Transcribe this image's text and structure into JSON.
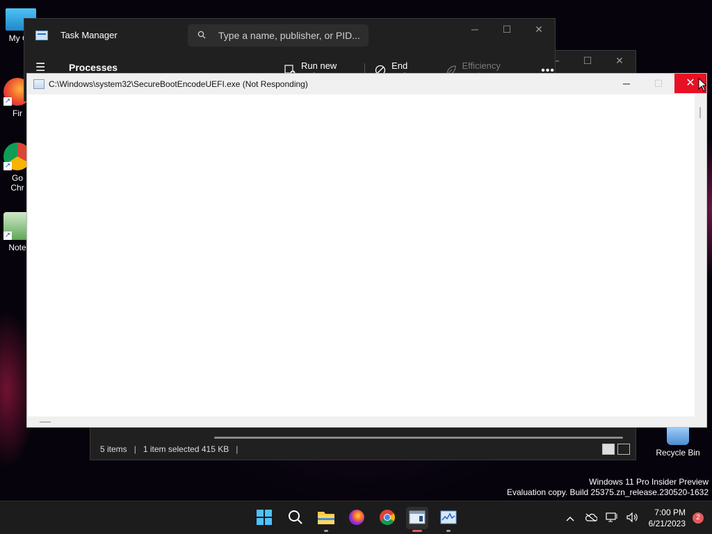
{
  "desktop": {
    "icons": [
      {
        "label": "My Co"
      },
      {
        "label": "Fir"
      },
      {
        "label": "Go\nChr"
      },
      {
        "label": "Note"
      },
      {
        "label": "Recycle Bin"
      }
    ],
    "watermark": {
      "line1": "Windows 11 Pro Insider Preview",
      "line2": "Evaluation copy. Build 25375.zn_release.230520-1632"
    }
  },
  "task_manager": {
    "title": "Task Manager",
    "search_placeholder": "Type a name, publisher, or PID...",
    "heading": "Processes",
    "toolbar": {
      "run_new_task": "Run new task",
      "end_task": "End task",
      "efficiency_mode": "Efficiency mode",
      "more": "•••"
    }
  },
  "back_window": {
    "status": {
      "items": "5 items",
      "selected": "1 item selected  415 KB",
      "sep": "|"
    }
  },
  "not_responding_window": {
    "title": "C:\\Windows\\system32\\SecureBootEncodeUEFI.exe (Not Responding)"
  },
  "taskbar": {
    "time": "7:00 PM",
    "date": "6/21/2023",
    "notification_count": "2"
  },
  "colors": {
    "close_button": "#e81123",
    "notification_badge": "#e35b5b",
    "active_app_indicator": "#e05c63"
  }
}
